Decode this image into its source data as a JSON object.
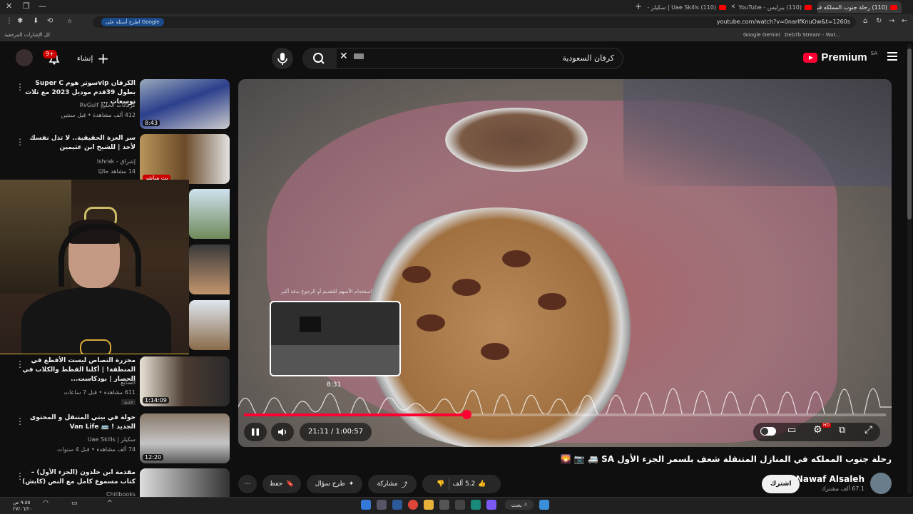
{
  "browser": {
    "tabs": [
      {
        "title": "(110) رحلة جنوب المملكه في",
        "active": true
      },
      {
        "title": "(110) بيرليس - YouTube"
      },
      {
        "title": "(110) Uae Skills | سكيلز - YouTube"
      },
      {
        "title": "Deb7b Stream - Wat"
      }
    ],
    "url": "youtube.com/watch?v=0narlfKnuOw&t=1260s",
    "ask_chip": "اطرح أسئلة على Google",
    "bookmarks": [
      "Google Gemini",
      "Deb7b Stream - Wat...",
      "كل الإشارات المرجعية"
    ]
  },
  "header": {
    "logo_word": "Premium",
    "logo_region": "SA",
    "search_value": "كرفان السعودية",
    "create_label": "إنشاء",
    "notif_count": "9+"
  },
  "player": {
    "current_time": "21:11",
    "duration": "1:00:57",
    "time_display": "21:11 / 1:00:57",
    "hover_time": "8:31",
    "preview_caption": "استخدام الأسهم للتقديم أو الرجوع بدقة أكبر",
    "progress_fraction": 0.347
  },
  "video": {
    "title": "رحلة جنوب المملكه في المنازل المتنقلة شعف بلسمر الجزء الأول SA 🚐 📷 🌄",
    "channel": "Nawaf Alsaleh",
    "subscribers": "67.1 ألف مشترك",
    "subscribe_label": "اشترك",
    "likes": "5.2 ألف",
    "share_label": "مشاركة",
    "ask_label": "طرح سؤال",
    "save_label": "حفظ"
  },
  "sidebar": {
    "items": [
      {
        "title": "الكرفان vipسوتر هوم Super C بطول 39قدم موديل 2023 مع ثلاث توسعات ...",
        "channel": "كرفانات الخليج RvGulf",
        "meta": "412 ألف مشاهدة • قبل سنتين",
        "duration": "8:43"
      },
      {
        "title": "سر العزة الحقيقية.. لا تذل نفسك لأحد | للشيخ ابن عثيمين",
        "channel": "إشراق - Ishrak",
        "meta": "14 مشاهد حاليًا",
        "duration": "بث مباشر"
      },
      {
        "title": "",
        "channel": "",
        "meta": "",
        "duration": ""
      },
      {
        "title": "",
        "channel": "",
        "meta": "",
        "duration": ""
      },
      {
        "title": "",
        "channel": "",
        "meta": "",
        "duration": ""
      },
      {
        "title": "مجزرة التصاص ليست الأفظع في المنطقة! | أكلنا القطط والكلاب في الحصار | بودكاست...",
        "channel": "السابع",
        "meta": "611 مشاهدة • قبل 7 ساعات",
        "duration": "1:14:09",
        "tag": "جديد"
      },
      {
        "title": "جولة في بيتي المتنقل و المحتوى الجديد ! 🚌 Van Life",
        "channel": "سكيلز | Uae Skills",
        "meta": "74 ألف مشاهدة • قبل 4 سنوات",
        "duration": "12:20"
      },
      {
        "title": "مقدمة ابن خلدون (الجزء الأول) – كتاب مسموع كامل مع النص (كابش)",
        "channel": "Chillbooks",
        "meta": "",
        "duration": ""
      }
    ]
  },
  "taskbar": {
    "search_label": "بحث",
    "clock_time": "٩:٥٥ ص",
    "clock_date": "٢٧/٠٦/٢٠"
  }
}
